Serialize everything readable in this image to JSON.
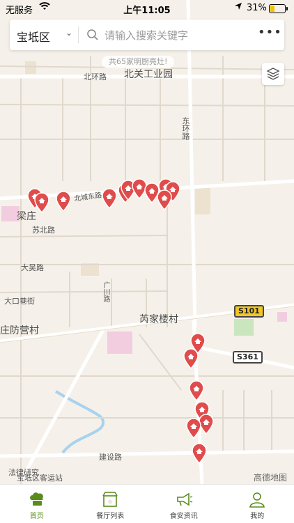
{
  "status_bar": {
    "carrier": "无服务",
    "time": "上午11:05",
    "battery_percent_label": "31%",
    "battery_level": 0.31
  },
  "search": {
    "district": "宝坻区",
    "placeholder": "请输入搜索关键字",
    "value": ""
  },
  "notice": "共65家明厨亮灶!",
  "map": {
    "labels": {
      "north_ring_rd": "北环路",
      "north_gate_industrial": "北关工业园",
      "east_ring_rd": "东环路",
      "north_city_east_rd": "北城东路",
      "liangzhuang": "梁庄",
      "subei_rd": "苏北路",
      "dawu_rd": "大吴路",
      "dakou_lane": "大口巷街",
      "guangchuan_rd": "广川路",
      "ruijia_louzi": "芮家楼村",
      "fangying": "庄防营村",
      "jianshe_rd": "建设路",
      "bus_station": "宝坻区客运站",
      "court": "法律研究"
    },
    "shields": {
      "s101": "S101",
      "s361": "S361"
    },
    "attribution": "高德地图",
    "marker_color": "#e04b4b"
  },
  "tabs": [
    {
      "label": "首页",
      "icon": "chef-hat-icon",
      "active": true
    },
    {
      "label": "餐厅列表",
      "icon": "restaurant-icon",
      "active": false
    },
    {
      "label": "食安资讯",
      "icon": "megaphone-icon",
      "active": false
    },
    {
      "label": "我的",
      "icon": "user-icon",
      "active": false
    }
  ],
  "colors": {
    "accent_green": "#5a8c1c",
    "marker_red": "#e04b4b"
  }
}
